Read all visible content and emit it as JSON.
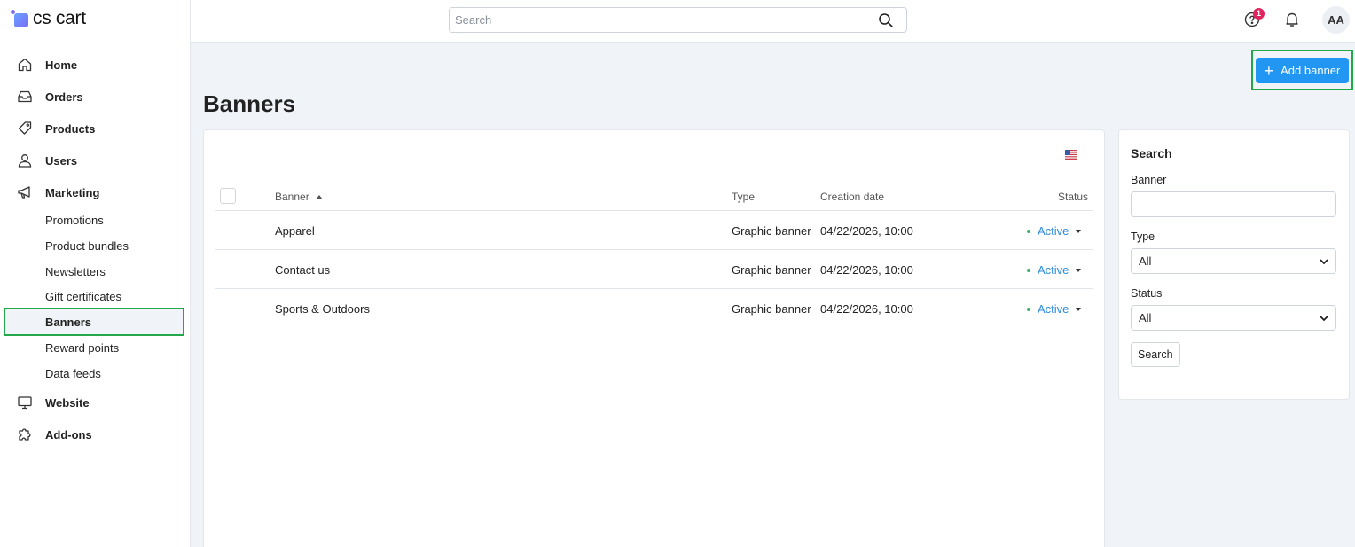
{
  "app": {
    "logo_text": "cs cart"
  },
  "sidebar": {
    "items": [
      {
        "label": "Home",
        "icon": "home-icon"
      },
      {
        "label": "Orders",
        "icon": "inbox-icon"
      },
      {
        "label": "Products",
        "icon": "tag-icon"
      },
      {
        "label": "Users",
        "icon": "user-icon"
      },
      {
        "label": "Marketing",
        "icon": "megaphone-icon"
      },
      {
        "label": "Website",
        "icon": "monitor-icon"
      },
      {
        "label": "Add-ons",
        "icon": "puzzle-icon"
      }
    ],
    "marketing_sub": [
      {
        "label": "Promotions"
      },
      {
        "label": "Product bundles"
      },
      {
        "label": "Newsletters"
      },
      {
        "label": "Gift certificates"
      },
      {
        "label": "Banners",
        "active": true
      },
      {
        "label": "Reward points"
      },
      {
        "label": "Data feeds"
      }
    ]
  },
  "topbar": {
    "search_placeholder": "Search",
    "notifications_badge": "1",
    "avatar_initials": "AA"
  },
  "page": {
    "title": "Banners",
    "add_button_label": "Add banner"
  },
  "table": {
    "columns": {
      "banner": "Banner",
      "type": "Type",
      "created": "Creation date",
      "status": "Status"
    },
    "rows": [
      {
        "banner": "Apparel",
        "type": "Graphic banner",
        "created": "04/22/2026, 10:00",
        "status": "Active"
      },
      {
        "banner": "Contact us",
        "type": "Graphic banner",
        "created": "04/22/2026, 10:00",
        "status": "Active"
      },
      {
        "banner": "Sports & Outdoors",
        "type": "Graphic banner",
        "created": "04/22/2026, 10:00",
        "status": "Active"
      }
    ]
  },
  "search_panel": {
    "title": "Search",
    "banner_label": "Banner",
    "banner_value": "",
    "type_label": "Type",
    "type_value": "All",
    "status_label": "Status",
    "status_value": "All",
    "button_label": "Search"
  },
  "colors": {
    "primary": "#2196f3",
    "active_status": "#2b8be0",
    "highlight": "#22a84a",
    "badge": "#e0245e"
  }
}
